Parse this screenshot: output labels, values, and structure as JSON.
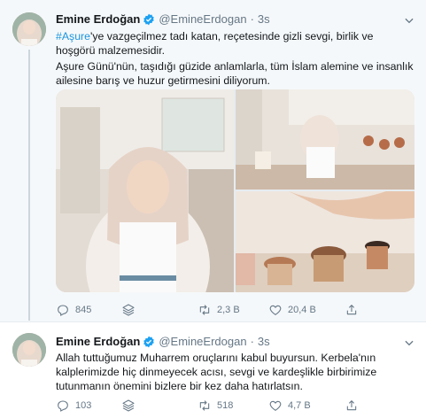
{
  "tweets": [
    {
      "name": "Emine Erdoğan",
      "handle": "@EmineErdogan",
      "separator": "·",
      "time": "3s",
      "hashtag": "#Aşure",
      "text_after_hashtag": "'ye vazgeçilmez tadı katan, reçetesinde gizli sevgi, birlik ve hoşgörü malzemesidir.",
      "paragraph2": "Aşure Günü'nün, taşıdığı güzide anlamlarla, tüm İslam alemine ve insanlık ailesine barış ve huzur getirmesini diliyorum.",
      "stats": {
        "replies": "845",
        "retweets": "2,3 B",
        "likes": "20,4 B"
      }
    },
    {
      "name": "Emine Erdoğan",
      "handle": "@EmineErdogan",
      "separator": "·",
      "time": "3s",
      "text": "Allah tuttuğumuz Muharrem oruçlarını kabul buyursun. Kerbela'nın kalplerimizde hiç dinmeyecek acısı, sevgi ve kardeşlikle birbirimize tutunmanın önemini bizlere bir kez daha hatırlatsın.",
      "stats": {
        "replies": "103",
        "retweets": "518",
        "likes": "4,7 B"
      }
    }
  ],
  "colors": {
    "accent": "#1b95e0",
    "muted": "#657786",
    "thread": "#ccd6dd",
    "selected_bg": "#f5f8fa"
  },
  "icons": [
    "verified-badge-icon",
    "caret-down-icon",
    "reply-icon",
    "stack-icon",
    "retweet-icon",
    "like-icon",
    "share-icon"
  ]
}
